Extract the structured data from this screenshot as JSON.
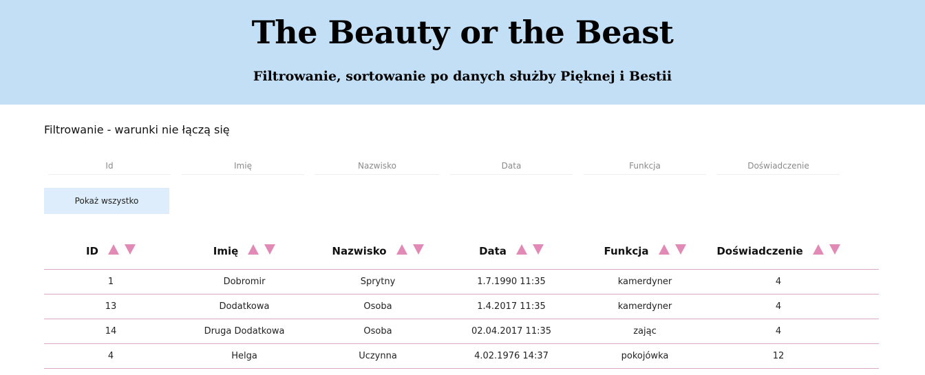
{
  "header": {
    "title": "The Beauty or the Beast",
    "subtitle": "Filtrowanie, sortowanie po danych służby Pięknej i Bestii"
  },
  "filters": {
    "section_title": "Filtrowanie - warunki nie łączą się",
    "inputs": [
      {
        "placeholder": "Id",
        "value": ""
      },
      {
        "placeholder": "Imię",
        "value": ""
      },
      {
        "placeholder": "Nazwisko",
        "value": ""
      },
      {
        "placeholder": "Data",
        "value": ""
      },
      {
        "placeholder": "Funkcja",
        "value": ""
      },
      {
        "placeholder": "Doświadczenie",
        "value": ""
      }
    ],
    "show_all_label": "Pokaż wszystko"
  },
  "table": {
    "columns": [
      "ID",
      "Imię",
      "Nazwisko",
      "Data",
      "Funkcja",
      "Doświadczenie"
    ],
    "rows": [
      [
        "1",
        "Dobromir",
        "Sprytny",
        "1.7.1990 11:35",
        "kamerdyner",
        "4"
      ],
      [
        "13",
        "Dodatkowa",
        "Osoba",
        "1.4.2017 11:35",
        "kamerdyner",
        "4"
      ],
      [
        "14",
        "Druga Dodatkowa",
        "Osoba",
        "02.04.2017 11:35",
        "zając",
        "4"
      ],
      [
        "4",
        "Helga",
        "Uczynna",
        "4.02.1976 14:37",
        "pokojówka",
        "12"
      ]
    ]
  },
  "colors": {
    "header_bg": "#c2dff6",
    "button_bg": "#deedfb",
    "sort_arrow": "#e28ab6",
    "row_border": "#d8a8c4"
  },
  "icons": {
    "sort_asc": "triangle-up-icon",
    "sort_desc": "triangle-down-icon"
  }
}
